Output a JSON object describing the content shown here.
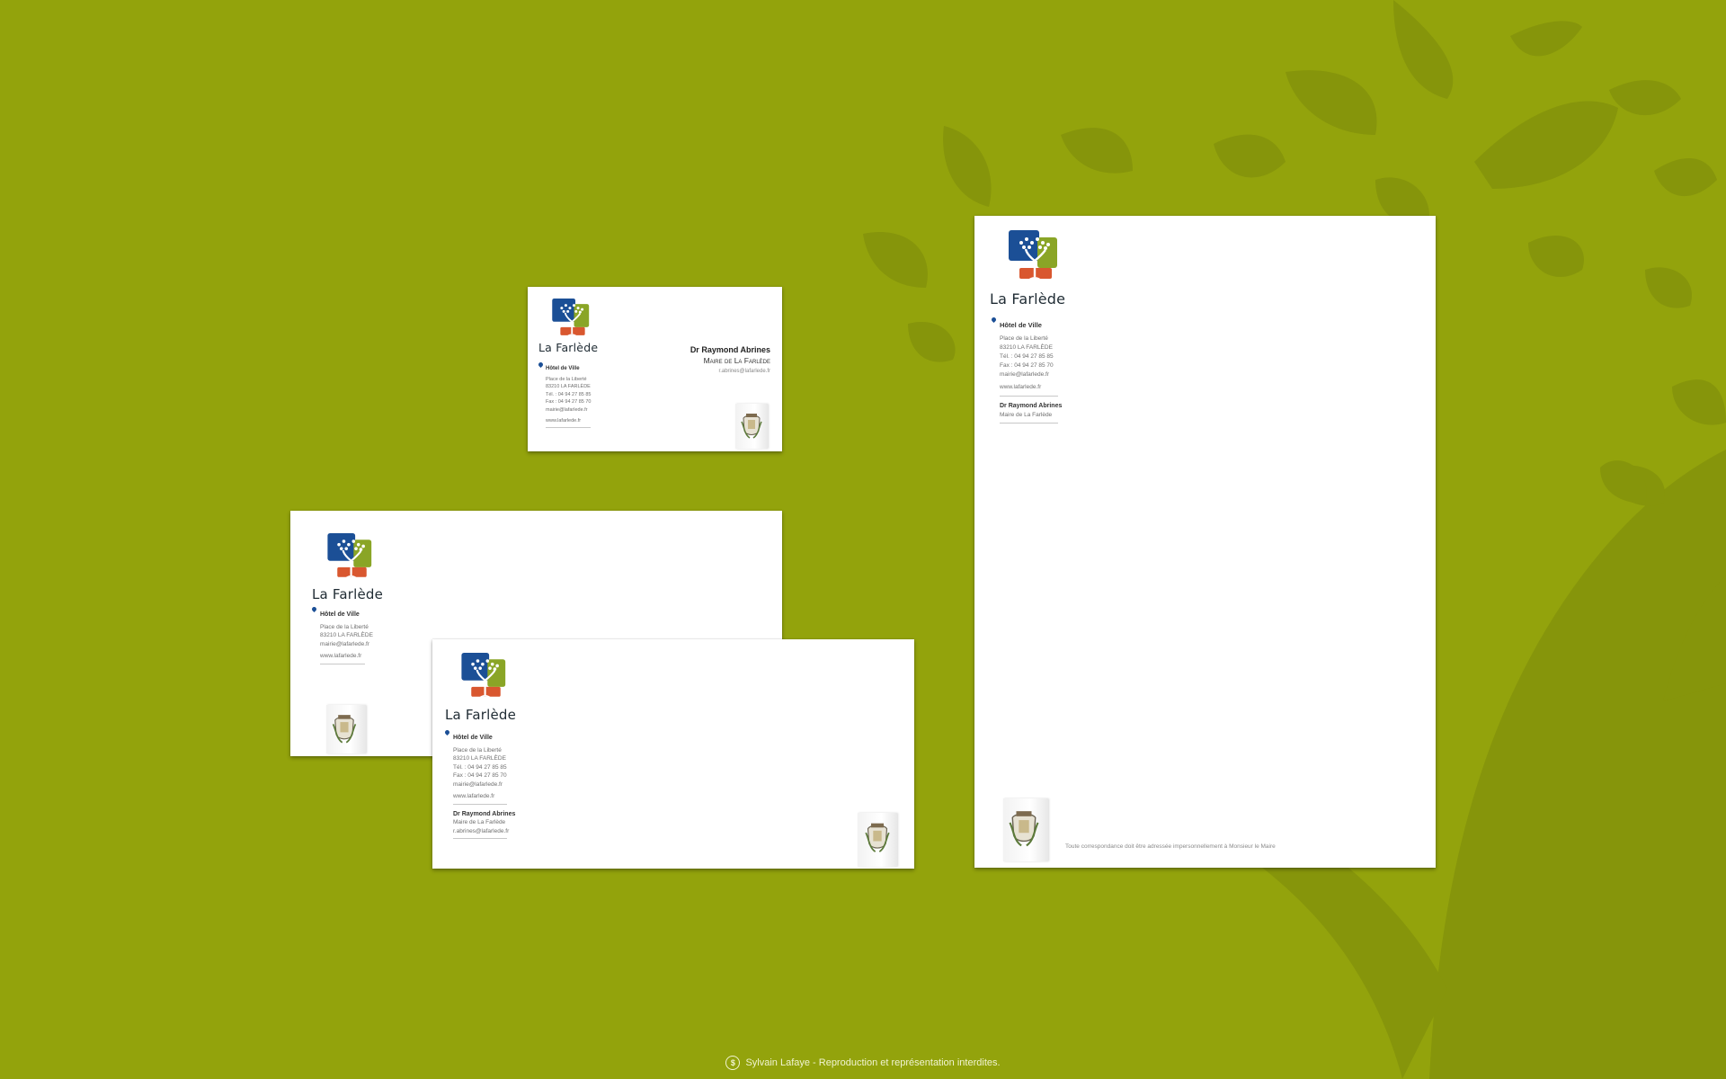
{
  "brand": {
    "name": "La Farlède",
    "colors": {
      "blue": "#1b4f96",
      "green": "#8aa526",
      "red": "#d9572f",
      "background": "#93a30c"
    }
  },
  "business_card": {
    "brand": "La Farlède",
    "office_title": "Hôtel de Ville",
    "address_lines": [
      "Place de la Liberté",
      "83210 LA FARLÈDE",
      "Tél. : 04 94 27 85 85",
      "Fax : 04 94 27 85 70",
      "mairie@lafarlede.fr"
    ],
    "website": "www.lafarlede.fr",
    "person_name": "Dr Raymond Abrines",
    "person_role": "Maire de La Farlède",
    "person_email": "r.abrines@lafarlede.fr"
  },
  "envelope_small": {
    "brand": "La Farlède",
    "office_title": "Hôtel de Ville",
    "address_lines": [
      "Place de la Liberté",
      "83210 LA FARLÈDE",
      "mairie@lafarlede.fr"
    ],
    "website": "www.lafarlede.fr"
  },
  "envelope_large": {
    "brand": "La Farlède",
    "office_title": "Hôtel de Ville",
    "address_lines": [
      "Place de la Liberté",
      "83210 LA FARLÈDE",
      "Tél. : 04 94 27 85 85",
      "Fax : 04 94 27 85 70",
      "mairie@lafarlede.fr"
    ],
    "website": "www.lafarlede.fr",
    "person_name": "Dr Raymond Abrines",
    "person_role": "Maire de La Farlède",
    "person_email": "r.abrines@lafarlede.fr"
  },
  "letterhead": {
    "brand": "La Farlède",
    "office_title": "Hôtel de Ville",
    "address_lines": [
      "Place de la Liberté",
      "83210 LA FARLÈDE",
      "Tél. : 04 94 27 85 85",
      "Fax : 04 94 27 85 70",
      "mairie@lafarlede.fr"
    ],
    "website": "www.lafarlede.fr",
    "person_name": "Dr Raymond Abrines",
    "person_role": "Maire de La Farlède",
    "footer_note": "Toute correspondance doit être adressée impersonnellement à Monsieur le Maire"
  },
  "footer": {
    "license_icon": "creative-commons-icon",
    "text": "Sylvain Lafaye - Reproduction et représentation interdites."
  }
}
